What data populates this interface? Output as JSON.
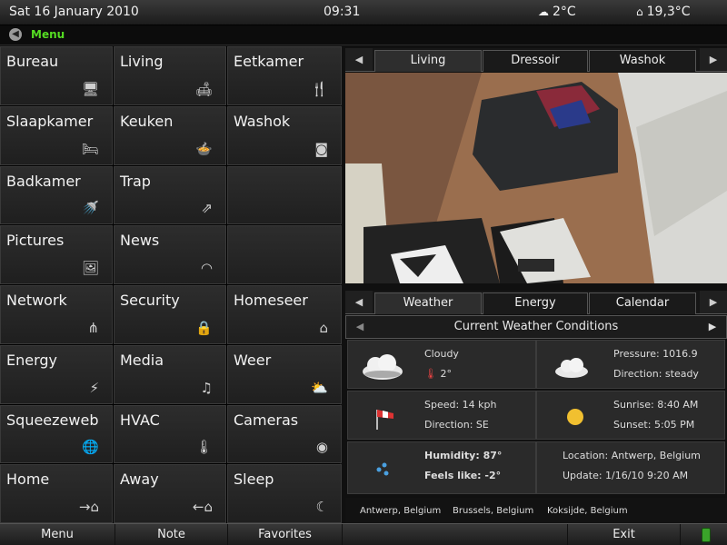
{
  "status": {
    "date": "Sat 16 January 2010",
    "time": "09:31",
    "outdoor_temp": "2°C",
    "indoor_temp": "19,3°C"
  },
  "menubar": {
    "menu_label": "Menu"
  },
  "tiles": [
    {
      "label": "Bureau",
      "icon": "computer-icon"
    },
    {
      "label": "Living",
      "icon": "sofa-icon"
    },
    {
      "label": "Eetkamer",
      "icon": "cutlery-icon"
    },
    {
      "label": "Slaapkamer",
      "icon": "bed-icon"
    },
    {
      "label": "Keuken",
      "icon": "pot-icon"
    },
    {
      "label": "Washok",
      "icon": "washing-machine-icon"
    },
    {
      "label": "Badkamer",
      "icon": "shower-icon"
    },
    {
      "label": "Trap",
      "icon": "stairs-icon"
    },
    {
      "label": "",
      "icon": ""
    },
    {
      "label": "Pictures",
      "icon": "pictures-icon"
    },
    {
      "label": "News",
      "icon": "rss-icon"
    },
    {
      "label": "",
      "icon": ""
    },
    {
      "label": "Network",
      "icon": "network-icon"
    },
    {
      "label": "Security",
      "icon": "lock-icon"
    },
    {
      "label": "Homeseer",
      "icon": "house-icon"
    },
    {
      "label": "Energy",
      "icon": "plug-icon"
    },
    {
      "label": "Media",
      "icon": "music-icon"
    },
    {
      "label": "Weer",
      "icon": "weather-icon"
    },
    {
      "label": "Squeezeweb",
      "icon": "globe-icon"
    },
    {
      "label": "HVAC",
      "icon": "thermometer-icon"
    },
    {
      "label": "Cameras",
      "icon": "eye-icon"
    },
    {
      "label": "Home",
      "icon": "arrive-home-icon"
    },
    {
      "label": "Away",
      "icon": "leave-home-icon"
    },
    {
      "label": "Sleep",
      "icon": "sleep-icon"
    }
  ],
  "camera_tabs": [
    "Living",
    "Dressoir",
    "Washok"
  ],
  "info_tabs": [
    "Weather",
    "Energy",
    "Calendar"
  ],
  "weather": {
    "title": "Current Weather Conditions",
    "condition": "Cloudy",
    "temp": "2°",
    "pressure": "Pressure: 1016.9",
    "direction_pressure": "Direction: steady",
    "wind_speed": "Speed: 14 kph",
    "wind_direction": "Direction: SE",
    "sunrise": "Sunrise: 8:40 AM",
    "sunset": "Sunset: 5:05 PM",
    "humidity": "Humidity: 87°",
    "feels_like": "Feels like: -2°",
    "location": "Location: Antwerp, Belgium",
    "update": "Update: 1/16/10 9:20 AM"
  },
  "locations": [
    "Antwerp, Belgium",
    "Brussels, Belgium",
    "Koksijde, Belgium"
  ],
  "bottom": {
    "menu": "Menu",
    "note": "Note",
    "favorites": "Favorites",
    "exit": "Exit"
  }
}
